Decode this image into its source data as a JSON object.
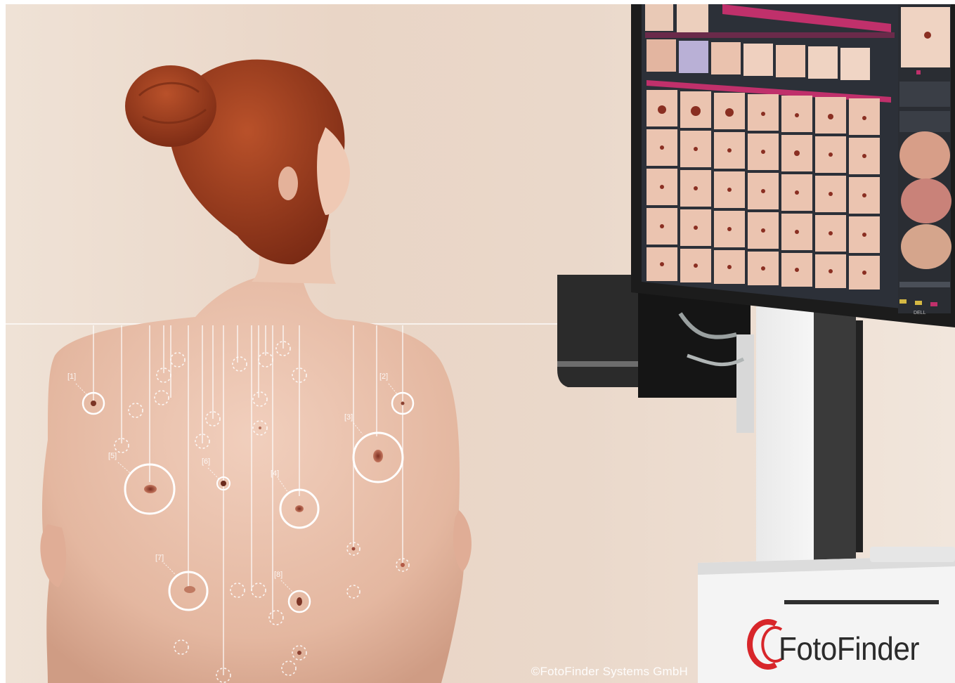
{
  "header": {
    "caption_fragment": "",
    "link_fragment": ""
  },
  "photo": {
    "credit": "©FotoFinder Systems GmbH",
    "brand": "FotoFinder",
    "monitor_brand": "DELL",
    "spot_labels": [
      "[1]",
      "[2]",
      "[3]",
      "[4]",
      "[5]",
      "[6]",
      "[7]",
      "[8]"
    ]
  },
  "colors": {
    "background": "#eedcd0",
    "skin": "#e3b9a2",
    "hair": "#9a3b1e",
    "screen_accent": "#c0306b",
    "logo_red": "#d8262a"
  }
}
